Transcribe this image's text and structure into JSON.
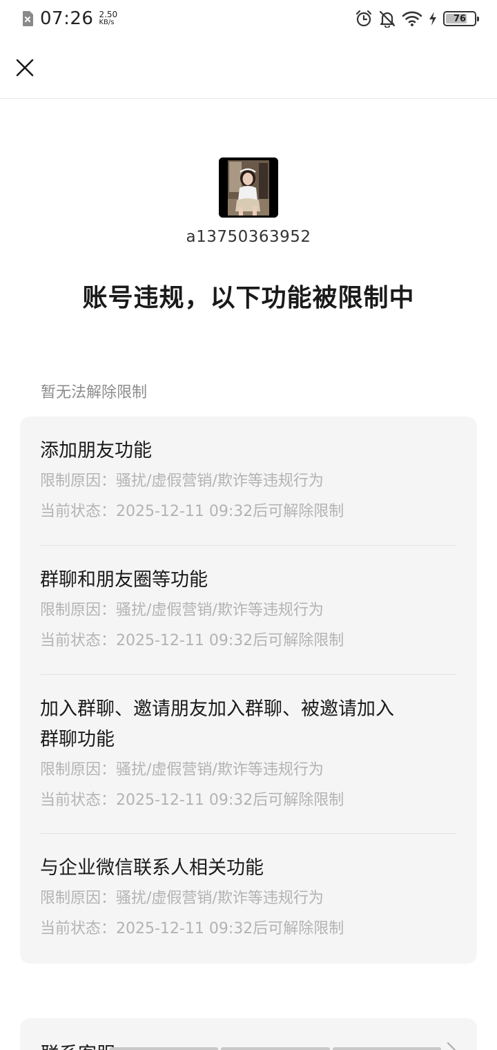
{
  "status_bar": {
    "time": "07:26",
    "speed_value": "2.50",
    "speed_unit": "KB/s",
    "battery": "76",
    "battery_level": 0.76,
    "icons": [
      "sim-off-icon",
      "alarm-icon",
      "bell-off-icon",
      "wifi-icon",
      "charging-icon",
      "battery-icon"
    ]
  },
  "header": {
    "close_icon": "close-icon"
  },
  "profile": {
    "account_id": "a13750363952"
  },
  "title": "账号违规，以下功能被限制中",
  "section_label": "暂无法解除限制",
  "restrictions": [
    {
      "title_lines": [
        "添加朋友功能"
      ],
      "reason": "限制原因：骚扰/虚假营销/欺诈等违规行为",
      "status": "当前状态：2025-12-11 09:32后可解除限制"
    },
    {
      "title_lines": [
        "群聊和朋友圈等功能"
      ],
      "reason": "限制原因：骚扰/虚假营销/欺诈等违规行为",
      "status": "当前状态：2025-12-11 09:32后可解除限制"
    },
    {
      "title_lines": [
        "加入群聊、邀请朋友加入群聊、被邀请加入",
        "群聊功能"
      ],
      "reason": "限制原因：骚扰/虚假营销/欺诈等违规行为",
      "status": "当前状态：2025-12-11 09:32后可解除限制"
    },
    {
      "title_lines": [
        "与企业微信联系人相关功能"
      ],
      "reason": "限制原因：骚扰/虚假营销/欺诈等违规行为",
      "status": "当前状态：2025-12-11 09:32后可解除限制"
    }
  ],
  "contact": {
    "label": "联系客服"
  },
  "colors": {
    "background": "#ffffff",
    "card": "#f5f5f5",
    "text_primary": "#1a1a1a",
    "text_secondary": "#b3b3b3",
    "section_label": "#8c8c8c"
  }
}
